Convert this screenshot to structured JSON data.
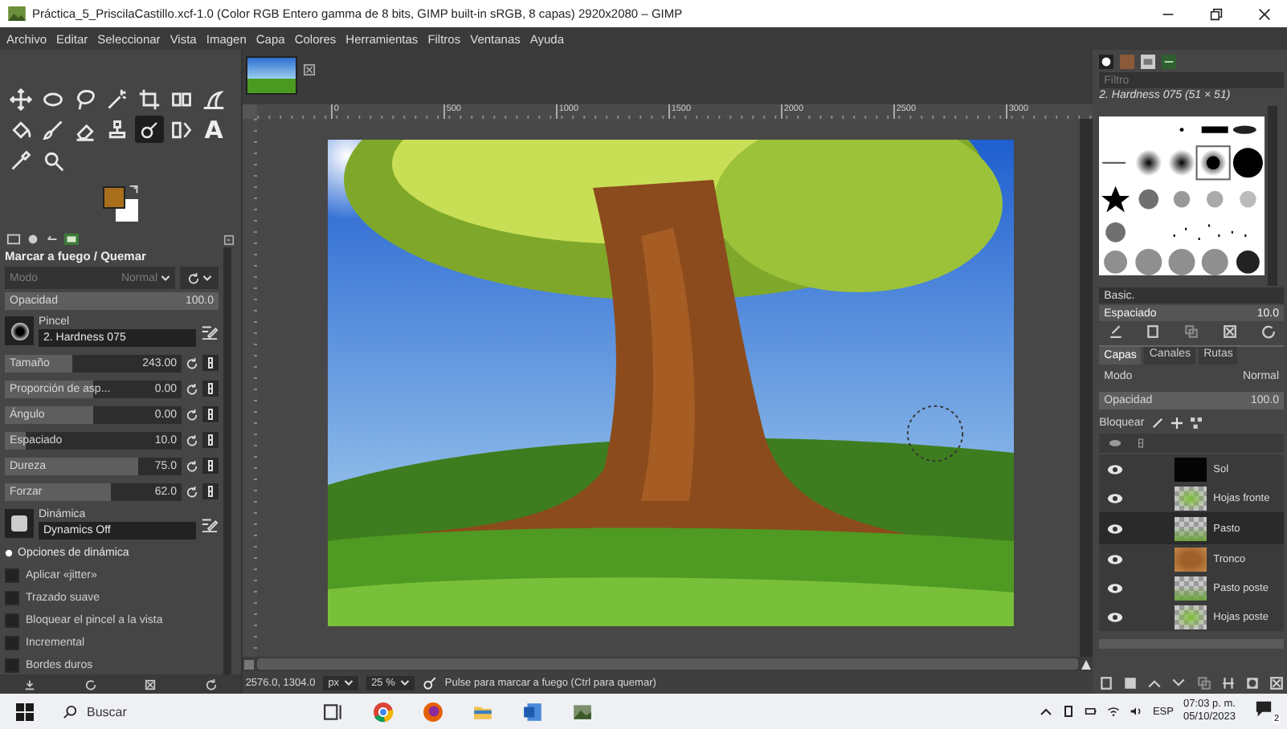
{
  "window": {
    "title": "Práctica_5_PriscilaCastillo.xcf-1.0 (Color RGB Entero gamma de 8 bits, GIMP built-in sRGB, 8 capas) 2920x2080 – GIMP"
  },
  "menu": [
    "Archivo",
    "Editar",
    "Seleccionar",
    "Vista",
    "Imagen",
    "Capa",
    "Colores",
    "Herramientas",
    "Filtros",
    "Ventanas",
    "Ayuda"
  ],
  "tools": [
    {
      "kind": "move",
      "selected": false
    },
    {
      "kind": "ellipse",
      "selected": false
    },
    {
      "kind": "lasso",
      "selected": false
    },
    {
      "kind": "wand",
      "selected": false
    },
    {
      "kind": "crop",
      "selected": false
    },
    {
      "kind": "transform",
      "selected": false
    },
    {
      "kind": "warp",
      "selected": false
    },
    {
      "kind": "bucket",
      "selected": false
    },
    {
      "kind": "brush",
      "selected": false
    },
    {
      "kind": "smudge",
      "selected": false
    },
    {
      "kind": "clone",
      "selected": false
    },
    {
      "kind": "burn",
      "selected": true
    },
    {
      "kind": "gradient",
      "selected": false
    },
    {
      "kind": "glyph",
      "glyph": "A",
      "selected": false
    },
    {
      "kind": "picker",
      "selected": false
    },
    {
      "kind": "zoom",
      "selected": false
    }
  ],
  "tool_options": {
    "title": "Marcar a fuego / Quemar",
    "mode": {
      "label": "Modo",
      "value": "Normal",
      "disabled": true
    },
    "opacity": {
      "label": "Opacidad",
      "value": "100.0",
      "level": 1
    },
    "brush": {
      "label": "Pincel",
      "value": "2. Hardness 075"
    },
    "sliders": [
      {
        "label": "Tamaño",
        "value": "243.00",
        "level": 0.38
      },
      {
        "label": "Proporción de asp...",
        "value": "0.00",
        "level": 0.5
      },
      {
        "label": "Ángulo",
        "value": "0.00",
        "level": 0.5
      },
      {
        "label": "Espaciado",
        "value": "10.0",
        "level": 0.12
      },
      {
        "label": "Dureza",
        "value": "75.0",
        "level": 0.75
      },
      {
        "label": "Forzar",
        "value": "62.0",
        "level": 0.6
      }
    ],
    "dynamics": {
      "label": "Dinámica",
      "value": "Dynamics Off"
    },
    "dynamics_options": {
      "label": "Opciones de dinámica"
    },
    "checkboxes": [
      {
        "label": "Aplicar «jitter»",
        "checked": false
      },
      {
        "label": "Trazado suave",
        "checked": false
      },
      {
        "label": "Bloquear el pincel a la vista",
        "checked": false
      },
      {
        "label": "Incremental",
        "checked": false
      },
      {
        "label": "Bordes duros",
        "checked": false
      }
    ]
  },
  "canvas": {
    "ruler_labels": [
      "0",
      "500",
      "1000",
      "1500",
      "2000",
      "2500",
      "3000"
    ],
    "status": {
      "coordinates": "2576.0, 1304.0",
      "unit": "px",
      "zoom": "25 %",
      "message": "Pulse para marcar a fuego (Ctrl para quemar)"
    }
  },
  "brushes": {
    "filter_placeholder": "Filtro",
    "title": "2. Hardness 075 (51 × 51)",
    "tag": "Basic.",
    "spacing": {
      "label": "Espaciado",
      "value": "10.0"
    }
  },
  "dock_tabs": [
    {
      "label": "Capas",
      "selected": true
    },
    {
      "label": "Canales",
      "selected": false
    },
    {
      "label": "Rutas",
      "selected": false
    }
  ],
  "layers_panel": {
    "mode": {
      "label": "Modo",
      "value": "Normal"
    },
    "opacity": {
      "label": "Opacidad",
      "value": "100.0",
      "level": 1
    },
    "lock_label": "Bloquear",
    "layers": [
      {
        "name": "Sol",
        "visible": true,
        "selected": false
      },
      {
        "name": "Hojas fronte",
        "visible": true,
        "selected": false
      },
      {
        "name": "Pasto",
        "visible": true,
        "selected": true
      },
      {
        "name": "Tronco",
        "visible": true,
        "selected": false
      },
      {
        "name": "Pasto poste",
        "visible": true,
        "selected": false
      },
      {
        "name": "Hojas poste",
        "visible": true,
        "selected": false
      }
    ]
  },
  "taskbar": {
    "search_placeholder": "Buscar",
    "language": "ESP",
    "time": "07:03 p. m.",
    "date": "05/10/2023",
    "notifications": "2"
  }
}
